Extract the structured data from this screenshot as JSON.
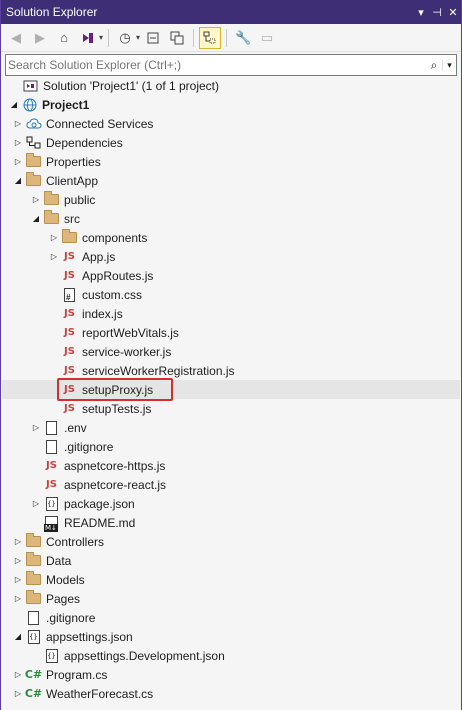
{
  "window": {
    "title": "Solution Explorer",
    "buttons": [
      "▾",
      "⊣",
      "✕"
    ]
  },
  "search": {
    "placeholder": "Search Solution Explorer (Ctrl+;)"
  },
  "colors": {
    "titlebar": "#3d2e75",
    "highlight_box": "#d32f2f",
    "js_icon": "#c4443c",
    "cs_icon": "#2a8a3b",
    "folder": "#dcb67a"
  },
  "tree": [
    {
      "label": "Solution 'Project1' (1 of 1 project)",
      "icon": "solution-icon",
      "indent": 0,
      "exp": "",
      "bold": false
    },
    {
      "label": "Project1",
      "icon": "web-project-icon",
      "indent": 0,
      "exp": "open",
      "bold": true
    },
    {
      "label": "Connected Services",
      "icon": "cloud-icon",
      "indent": 1,
      "exp": "closed"
    },
    {
      "label": "Dependencies",
      "icon": "dependencies-icon",
      "indent": 1,
      "exp": "closed"
    },
    {
      "label": "Properties",
      "icon": "folder-icon",
      "indent": 1,
      "exp": "closed"
    },
    {
      "label": "ClientApp",
      "icon": "folder-icon",
      "indent": 1,
      "exp": "open"
    },
    {
      "label": "public",
      "icon": "folder-icon",
      "indent": 2,
      "exp": "closed"
    },
    {
      "label": "src",
      "icon": "folder-icon",
      "indent": 2,
      "exp": "open"
    },
    {
      "label": "components",
      "icon": "folder-icon",
      "indent": 3,
      "exp": "closed"
    },
    {
      "label": "App.js",
      "icon": "js-icon",
      "indent": 3,
      "exp": "closed"
    },
    {
      "label": "AppRoutes.js",
      "icon": "js-icon",
      "indent": 3,
      "exp": ""
    },
    {
      "label": "custom.css",
      "icon": "css-icon",
      "indent": 3,
      "exp": ""
    },
    {
      "label": "index.js",
      "icon": "js-icon",
      "indent": 3,
      "exp": ""
    },
    {
      "label": "reportWebVitals.js",
      "icon": "js-icon",
      "indent": 3,
      "exp": ""
    },
    {
      "label": "service-worker.js",
      "icon": "js-icon",
      "indent": 3,
      "exp": ""
    },
    {
      "label": "serviceWorkerRegistration.js",
      "icon": "js-icon",
      "indent": 3,
      "exp": ""
    },
    {
      "label": "setupProxy.js",
      "icon": "js-icon",
      "indent": 3,
      "exp": "",
      "highlighted": true
    },
    {
      "label": "setupTests.js",
      "icon": "js-icon",
      "indent": 3,
      "exp": ""
    },
    {
      "label": ".env",
      "icon": "file-icon",
      "indent": 2,
      "exp": "closed"
    },
    {
      "label": ".gitignore",
      "icon": "file-icon",
      "indent": 2,
      "exp": ""
    },
    {
      "label": "aspnetcore-https.js",
      "icon": "js-icon",
      "indent": 2,
      "exp": ""
    },
    {
      "label": "aspnetcore-react.js",
      "icon": "js-icon",
      "indent": 2,
      "exp": ""
    },
    {
      "label": "package.json",
      "icon": "json-icon",
      "indent": 2,
      "exp": "closed"
    },
    {
      "label": "README.md",
      "icon": "markdown-icon",
      "indent": 2,
      "exp": ""
    },
    {
      "label": "Controllers",
      "icon": "folder-icon",
      "indent": 1,
      "exp": "closed"
    },
    {
      "label": "Data",
      "icon": "folder-icon",
      "indent": 1,
      "exp": "closed"
    },
    {
      "label": "Models",
      "icon": "folder-icon",
      "indent": 1,
      "exp": "closed"
    },
    {
      "label": "Pages",
      "icon": "folder-icon",
      "indent": 1,
      "exp": "closed"
    },
    {
      "label": ".gitignore",
      "icon": "file-icon",
      "indent": 1,
      "exp": ""
    },
    {
      "label": "appsettings.json",
      "icon": "json-icon",
      "indent": 1,
      "exp": "open"
    },
    {
      "label": "appsettings.Development.json",
      "icon": "json-icon",
      "indent": 2,
      "exp": ""
    },
    {
      "label": "Program.cs",
      "icon": "csharp-icon",
      "indent": 1,
      "exp": "closed"
    },
    {
      "label": "WeatherForecast.cs",
      "icon": "csharp-icon",
      "indent": 1,
      "exp": "closed"
    }
  ]
}
